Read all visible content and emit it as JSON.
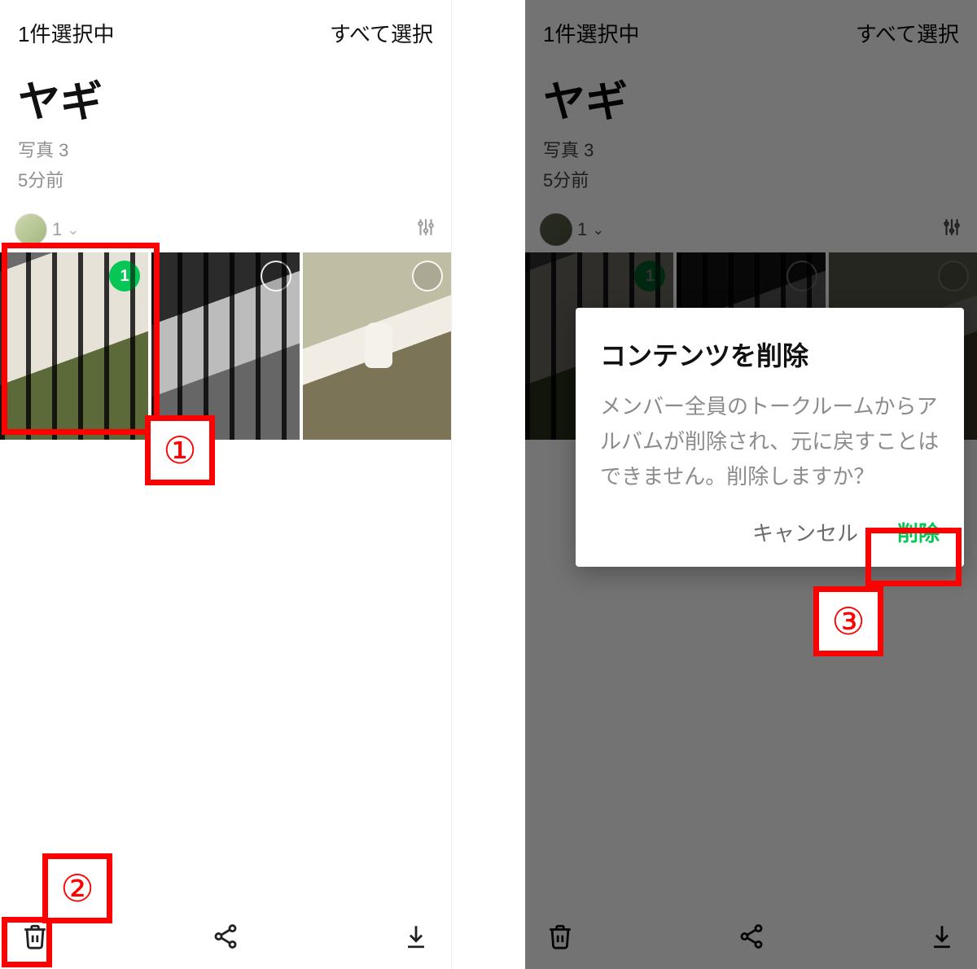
{
  "left": {
    "header": {
      "status": "1件選択中",
      "select_all": "すべて選択"
    },
    "album": {
      "title": "ヤギ",
      "photo_count": "写真 3",
      "time_ago": "5分前"
    },
    "filter": {
      "count": "1"
    },
    "thumbs": [
      {
        "selected": true,
        "badge": "1"
      },
      {
        "selected": false
      },
      {
        "selected": false
      }
    ],
    "annotations": {
      "step1": "①",
      "step2": "②"
    }
  },
  "right": {
    "header": {
      "status": "1件選択中",
      "select_all": "すべて選択"
    },
    "album": {
      "title": "ヤギ",
      "photo_count": "写真 3",
      "time_ago": "5分前"
    },
    "filter": {
      "count": "1"
    },
    "thumbs": [
      {
        "selected": true,
        "badge": "1"
      },
      {
        "selected": false
      },
      {
        "selected": false
      }
    ],
    "dialog": {
      "title": "コンテンツを削除",
      "body": "メンバー全員のトークルームからアルバムが削除され、元に戻すことはできません。削除しますか？",
      "cancel": "キャンセル",
      "delete": "削除"
    },
    "annotations": {
      "step3": "③"
    }
  },
  "colors": {
    "accent": "#06c755",
    "annotation": "#ff0000"
  }
}
